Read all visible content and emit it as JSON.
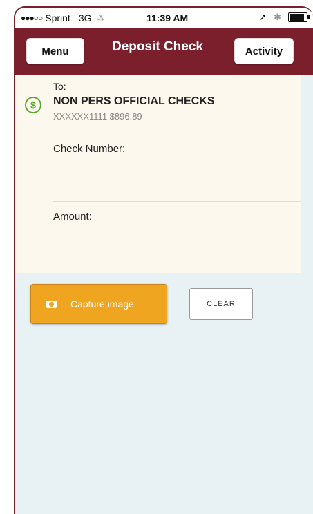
{
  "status_bar": {
    "signal": "●●●○○",
    "carrier": "Sprint",
    "network": "3G",
    "loading": "⁂",
    "time": "11:39 AM",
    "location_icon": "location-arrow-icon",
    "bluetooth_icon": "bluetooth-icon",
    "battery_icon": "battery-icon"
  },
  "nav": {
    "menu_label": "Menu",
    "title": "Deposit Check",
    "activity_label": "Activity"
  },
  "form": {
    "to_label": "To:",
    "payee": "NON PERS OFFICIAL CHECKS",
    "account": "XXXXXX1111 $896.89",
    "check_number_label": "Check Number:",
    "check_number_value": "",
    "amount_label": "Amount:",
    "amount_value": ""
  },
  "actions": {
    "capture_label": "Capture image",
    "clear_label": "CLEAR"
  },
  "colors": {
    "nav_bg": "#7b1f2c",
    "capture_bg": "#f0a521",
    "card_bg": "#fdf8ee",
    "page_bg": "#e8f2f4",
    "dollar_icon": "#5aa62b"
  }
}
